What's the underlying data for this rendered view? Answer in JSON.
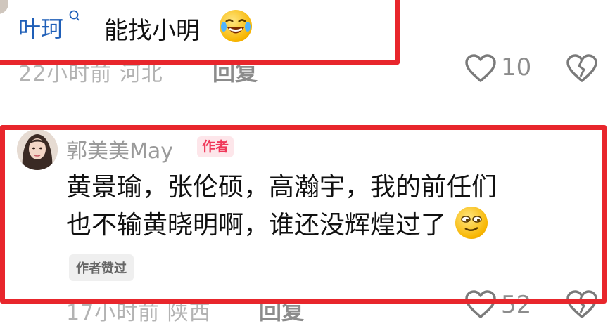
{
  "comment1": {
    "username": "叶珂",
    "text": "能找小明",
    "emoji": "laughing-tears-emoji",
    "meta": "22小时前 河北",
    "reply_label": "回复",
    "like_count": "10"
  },
  "comment2": {
    "username": "郭美美May",
    "author_tag": "作者",
    "text_line1": "黄景瑜，张伦硕，高瀚宇，我的前任们",
    "text_line2": "也不输黄晓明啊，谁还没辉煌过了",
    "emoji": "smug-emoji",
    "liked_tag": "作者赞过",
    "meta": "17小时前 陕西",
    "reply_label": "回复",
    "like_count": "52"
  },
  "colors": {
    "highlight_red": "#e8262c",
    "username_gray": "#9a9a9a",
    "author_tag_pink": "#f0385a"
  }
}
